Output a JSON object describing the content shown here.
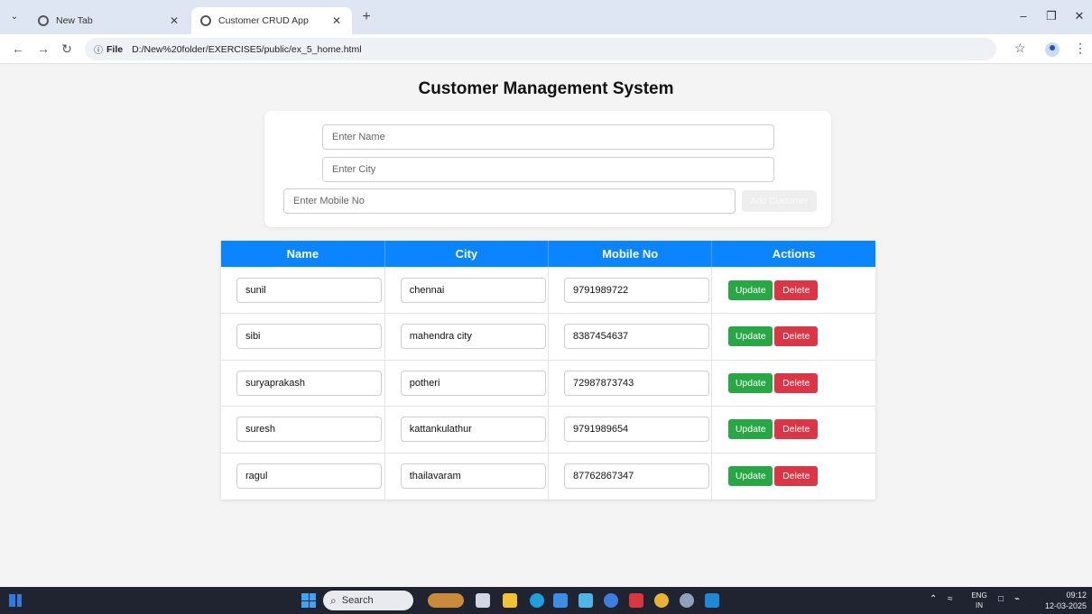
{
  "browser": {
    "tabs": [
      {
        "label": "New Tab",
        "active": false
      },
      {
        "label": "Customer CRUD App",
        "active": true
      }
    ],
    "address": {
      "chip": "File",
      "url": "D:/New%20folder/EXERCISE5/public/ex_5_home.html"
    }
  },
  "page": {
    "title": "Customer Management System"
  },
  "form": {
    "name_placeholder": "Enter Name",
    "city_placeholder": "Enter City",
    "mobile_placeholder": "Enter Mobile No",
    "add_label": "Add Customer"
  },
  "table": {
    "columns": [
      "Name",
      "City",
      "Mobile No",
      "Actions"
    ],
    "rows": [
      {
        "name": "sunil",
        "city": "chennai",
        "mobile": "9791989722"
      },
      {
        "name": "sibi",
        "city": "mahendra city",
        "mobile": "8387454637"
      },
      {
        "name": "suryaprakash",
        "city": "potheri",
        "mobile": "72987873743"
      },
      {
        "name": "suresh",
        "city": "kattankulathur",
        "mobile": "9791989654"
      },
      {
        "name": "ragul",
        "city": "thailavaram",
        "mobile": "87762867347"
      }
    ],
    "update_label": "Update",
    "delete_label": "Delete"
  },
  "taskbar": {
    "search_label": "Search",
    "lang_top": "ENG",
    "lang_bottom": "IN",
    "time": "09:12",
    "date": "12-03-2025"
  },
  "colors": {
    "header_blue": "#0a84ff",
    "update_green": "#28a745",
    "delete_red": "#dc3545"
  }
}
